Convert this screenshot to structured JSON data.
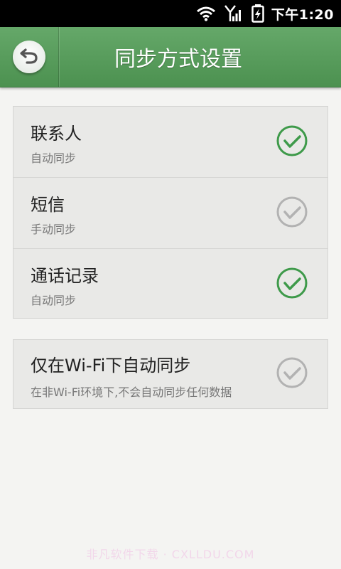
{
  "status_bar": {
    "time": "下午1:20",
    "icons": [
      "wifi-icon",
      "signal-icon",
      "battery-charging-icon"
    ]
  },
  "header": {
    "title": "同步方式设置",
    "back_icon": "back-arrow-icon"
  },
  "sync_items": [
    {
      "label": "联系人",
      "status": "自动同步",
      "checked": true
    },
    {
      "label": "短信",
      "status": "手动同步",
      "checked": false
    },
    {
      "label": "通话记录",
      "status": "自动同步",
      "checked": true
    }
  ],
  "wifi_option": {
    "label": "仅在Wi-Fi下自动同步",
    "description": "在非Wi-Fi环境下,不会自动同步任何数据",
    "checked": false
  },
  "watermark": "非凡软件下载 · CXLLDU.COM",
  "colors": {
    "title_bar": "#58a05c",
    "check_on": "#3e9a4a",
    "check_off": "#b2b2b2"
  }
}
